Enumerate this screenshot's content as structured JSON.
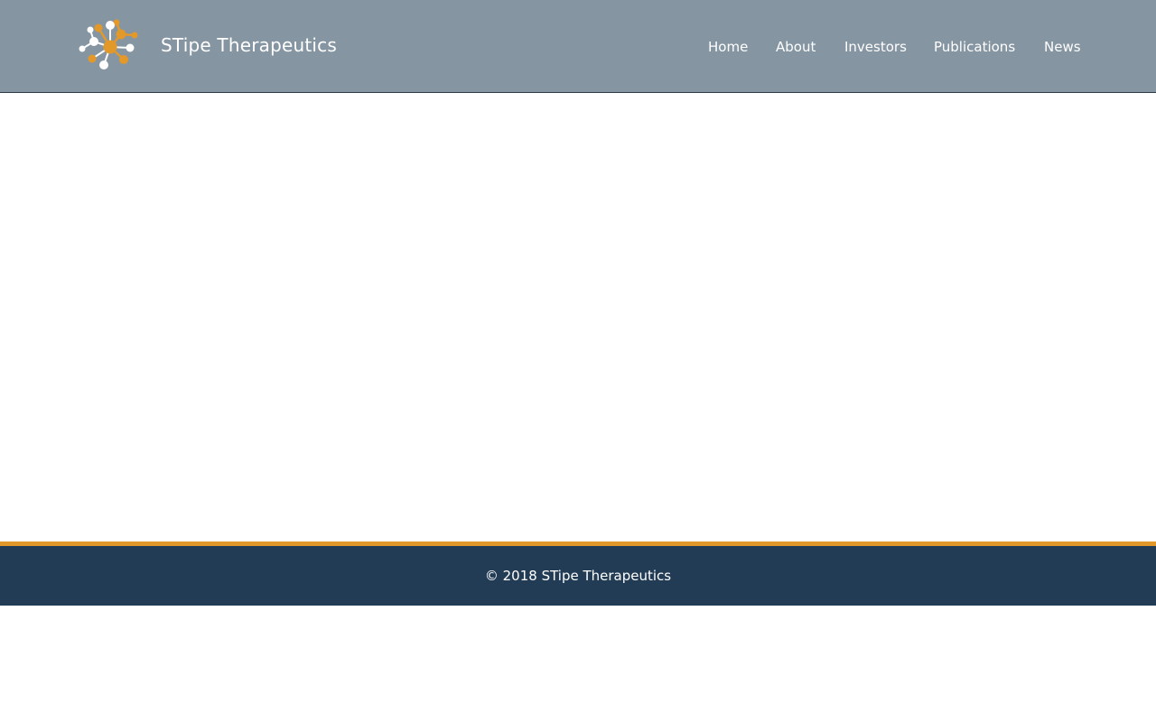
{
  "header": {
    "site_title": "STipe Therapeutics",
    "logo_icon": "molecule-icon",
    "background_color": "#8595a2"
  },
  "nav": {
    "items": [
      {
        "label": "Home"
      },
      {
        "label": "About"
      },
      {
        "label": "Investors"
      },
      {
        "label": "Publications"
      },
      {
        "label": "News"
      }
    ]
  },
  "footer": {
    "copyright": "© 2018 STipe Therapeutics",
    "accent_color": "#e3982a",
    "background_color": "#233c56"
  }
}
